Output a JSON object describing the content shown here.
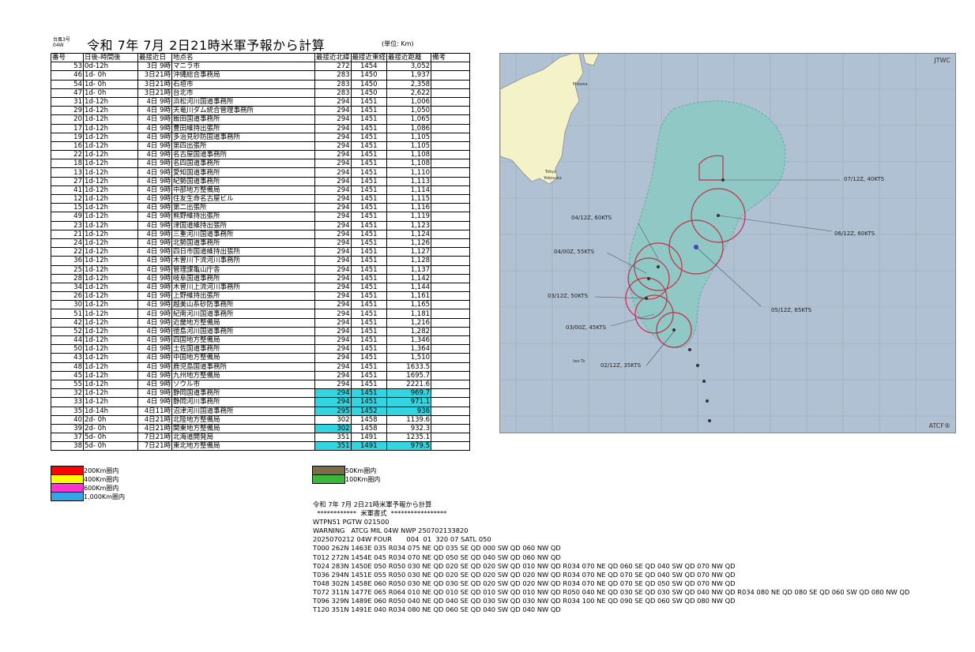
{
  "header": {
    "note_line1": "台風3号",
    "note_line2": "04W",
    "title": "令和 7年 7月 2日21時米軍予報から計算",
    "unit": "(単位: Km)"
  },
  "table": {
    "columns": [
      "番号",
      "日後-時間後",
      "最接近日",
      "地点名",
      "最接近北緯",
      "最接近東経",
      "最接近距離",
      "備考"
    ],
    "rows": [
      [
        "53",
        "0d-12h",
        "3日 9時",
        "マニラ市",
        "272",
        "1454",
        "3,052",
        ""
      ],
      [
        "46",
        "1d- 0h",
        "3日21時",
        "沖縄総合事務局",
        "283",
        "1450",
        "1,937",
        ""
      ],
      [
        "54",
        "1d- 0h",
        "3日21時",
        "石垣市",
        "283",
        "1450",
        "2,358",
        ""
      ],
      [
        "47",
        "1d- 0h",
        "3日21時",
        "台北市",
        "283",
        "1450",
        "2,622",
        ""
      ],
      [
        "31",
        "1d-12h",
        "4日 9時",
        "浜松河川国道事務所",
        "294",
        "1451",
        "1,006",
        ""
      ],
      [
        "29",
        "1d-12h",
        "4日 9時",
        "天竜川ダム統合管理事務所",
        "294",
        "1451",
        "1,050",
        ""
      ],
      [
        "20",
        "1d-12h",
        "4日 9時",
        "飯田国道事務所",
        "294",
        "1451",
        "1,065",
        ""
      ],
      [
        "17",
        "1d-12h",
        "4日 9時",
        "豊田維持出張所",
        "294",
        "1451",
        "1,086",
        ""
      ],
      [
        "19",
        "1d-12h",
        "4日 9時",
        "多治見砂防国道事務所",
        "294",
        "1451",
        "1,105",
        ""
      ],
      [
        "16",
        "1d-12h",
        "4日 9時",
        "第四出張所",
        "294",
        "1451",
        "1,105",
        ""
      ],
      [
        "22",
        "1d-12h",
        "4日 9時",
        "名古屋国道事務所",
        "294",
        "1451",
        "1,108",
        ""
      ],
      [
        "18",
        "1d-12h",
        "4日 9時",
        "名四国道事務所",
        "294",
        "1451",
        "1,108",
        ""
      ],
      [
        "13",
        "1d-12h",
        "4日 9時",
        "愛知国道事務所",
        "294",
        "1451",
        "1,110",
        ""
      ],
      [
        "27",
        "1d-12h",
        "4日 9時",
        "紀勢国道事務所",
        "294",
        "1451",
        "1,113",
        ""
      ],
      [
        "41",
        "1d-12h",
        "4日 9時",
        "中部地方整備局",
        "294",
        "1451",
        "1,114",
        ""
      ],
      [
        "12",
        "1d-12h",
        "4日 9時",
        "住友生命名古屋ビル",
        "294",
        "1451",
        "1,115",
        ""
      ],
      [
        "15",
        "1d-12h",
        "4日 9時",
        "第二出張所",
        "294",
        "1451",
        "1,116",
        ""
      ],
      [
        "49",
        "1d-12h",
        "4日 9時",
        "熊野維持出張所",
        "294",
        "1451",
        "1,119",
        ""
      ],
      [
        "23",
        "1d-12h",
        "4日 9時",
        "津国道維持出張所",
        "294",
        "1451",
        "1,123",
        ""
      ],
      [
        "21",
        "1d-12h",
        "4日 9時",
        "三重河川国道事務所",
        "294",
        "1451",
        "1,124",
        ""
      ],
      [
        "24",
        "1d-12h",
        "4日 9時",
        "北勢国道事務所",
        "294",
        "1451",
        "1,126",
        ""
      ],
      [
        "22",
        "1d-12h",
        "4日 9時",
        "四日市国道維持出張所",
        "294",
        "1451",
        "1,127",
        ""
      ],
      [
        "36",
        "1d-12h",
        "4日 9時",
        "木曽川下流河川事務所",
        "294",
        "1451",
        "1,128",
        ""
      ],
      [
        "25",
        "1d-12h",
        "4日 9時",
        "管理課亀山庁舎",
        "294",
        "1451",
        "1,137",
        ""
      ],
      [
        "28",
        "1d-12h",
        "4日 9時",
        "岐阜国道事務所",
        "294",
        "1451",
        "1,142",
        ""
      ],
      [
        "34",
        "1d-12h",
        "4日 9時",
        "木曽川上流河川事務所",
        "294",
        "1451",
        "1,144",
        ""
      ],
      [
        "26",
        "1d-12h",
        "4日 9時",
        "上野維持出張所",
        "294",
        "1451",
        "1,161",
        ""
      ],
      [
        "30",
        "1d-12h",
        "4日 9時",
        "越美山系砂防事務所",
        "294",
        "1451",
        "1,165",
        ""
      ],
      [
        "51",
        "1d-12h",
        "4日 9時",
        "紀南河川国道事務所",
        "294",
        "1451",
        "1,181",
        ""
      ],
      [
        "42",
        "1d-12h",
        "4日 9時",
        "近畿地方整備局",
        "294",
        "1451",
        "1,216",
        ""
      ],
      [
        "52",
        "1d-12h",
        "4日 9時",
        "徳島河川国道事務所",
        "294",
        "1451",
        "1,282",
        ""
      ],
      [
        "44",
        "1d-12h",
        "4日 9時",
        "四国地方整備局",
        "294",
        "1451",
        "1,346",
        ""
      ],
      [
        "50",
        "1d-12h",
        "4日 9時",
        "土佐国道事務所",
        "294",
        "1451",
        "1,364",
        ""
      ],
      [
        "43",
        "1d-12h",
        "4日 9時",
        "中国地方整備局",
        "294",
        "1451",
        "1,510",
        ""
      ],
      [
        "48",
        "1d-12h",
        "4日 9時",
        "鹿児島国道事務所",
        "294",
        "1451",
        "1633.5",
        ""
      ],
      [
        "45",
        "1d-12h",
        "4日 9時",
        "九州地方整備局",
        "294",
        "1451",
        "1695.7",
        ""
      ],
      [
        "55",
        "1d-12h",
        "4日 9時",
        "ソウル市",
        "294",
        "1451",
        "2221.6",
        ""
      ],
      [
        "32",
        "1d-12h",
        "4日 9時",
        "静岡国道事務所",
        "294",
        "1451",
        "969.7",
        ""
      ],
      [
        "33",
        "1d-12h",
        "4日 9時",
        "静岡河川事務所",
        "294",
        "1451",
        "971.1",
        ""
      ],
      [
        "35",
        "1d-14h",
        "4日11時",
        "沼津河川国道事務所",
        "295",
        "1452",
        "936",
        ""
      ],
      [
        "40",
        "2d- 0h",
        "4日21時",
        "北陸地方整備局",
        "302",
        "1458",
        "1139.6",
        ""
      ],
      [
        "39",
        "2d- 0h",
        "4日21時",
        "関東地方整備局",
        "302",
        "1458",
        "932.3",
        ""
      ],
      [
        "37",
        "5d- 0h",
        "7日21時",
        "北海道開発局",
        "351",
        "1491",
        "1235.1",
        ""
      ],
      [
        "38",
        "5d- 0h",
        "7日21時",
        "東北地方整備局",
        "351",
        "1491",
        "979.5",
        ""
      ]
    ],
    "row_highlight": {
      "37": "cyan",
      "38": "cyan",
      "39": "cyan",
      "41": "cyan_partial",
      "43": "cyan"
    },
    "highlight_color": "#33d6e0"
  },
  "legend": [
    {
      "label": "200Km圏内",
      "color": "#ff0000"
    },
    {
      "label": "400Km圏内",
      "color": "#ffff00"
    },
    {
      "label": "600Km圏内",
      "color": "#ff33cc"
    },
    {
      "label": "1,000Km圏内",
      "color": "#33a6e8"
    },
    {
      "label": "50Km圏内",
      "color": "#7a6e4a"
    },
    {
      "label": "100Km圏内",
      "color": "#3ab83a"
    }
  ],
  "map": {
    "jtwc": "JTWC",
    "atcf": "ATCF®",
    "cities": [
      "Misawa",
      "Tokyo",
      "Yokosuka",
      "Iwo To"
    ],
    "labels": [
      "07/12Z, 40KTS",
      "06/12Z, 60KTS",
      "04/12Z, 60KTS",
      "04/00Z, 55KTS",
      "03/12Z, 50KTS",
      "05/12Z, 65KTS",
      "03/00Z, 45KTS",
      "02/12Z, 35KTS"
    ]
  },
  "message": {
    "lines": [
      "令和 7年 7月 2日21時米軍予報から計算",
      "  ************  米軍書式  *****************",
      "WTPN51 PGTW 021500",
      "WARNING   ATCG MIL 04W NWP 250702133820",
      "2025070212 04W FOUR       004  01  320 07 SATL 050",
      "T000 262N 1463E 035 R034 075 NE QD 035 SE QD 000 SW QD 060 NW QD",
      "T012 272N 1454E 045 R034 070 NE QD 050 SE QD 040 SW QD 060 NW QD",
      "T024 283N 1450E 050 R050 030 NE QD 020 SE QD 020 SW QD 010 NW QD R034 070 NE QD 060 SE QD 040 SW QD 070 NW QD",
      "T036 294N 1451E 055 R050 030 NE QD 020 SE QD 020 SW QD 020 NW QD R034 070 NE QD 070 SE QD 040 SW QD 070 NW QD",
      "T048 302N 1458E 060 R050 030 NE QD 030 SE QD 020 SW QD 020 NW QD R034 070 NE QD 070 SE QD 050 SW QD 070 NW QD",
      "T072 311N 1477E 065 R064 010 NE QD 010 SE QD 010 SW QD 010 NW QD R050 040 NE QD 030 SE QD 030 SW QD 040 NW QD R034 080 NE QD 080 SE QD 060 SW QD 080 NW QD",
      "T096 329N 1489E 060 R050 040 NE QD 040 SE QD 030 SW QD 030 NW QD R034 100 NE QD 090 SE QD 060 SW QD 080 NW QD",
      "T120 351N 1491E 040 R034 080 NE QD 060 SE QD 040 SW QD 040 NW QD"
    ]
  }
}
